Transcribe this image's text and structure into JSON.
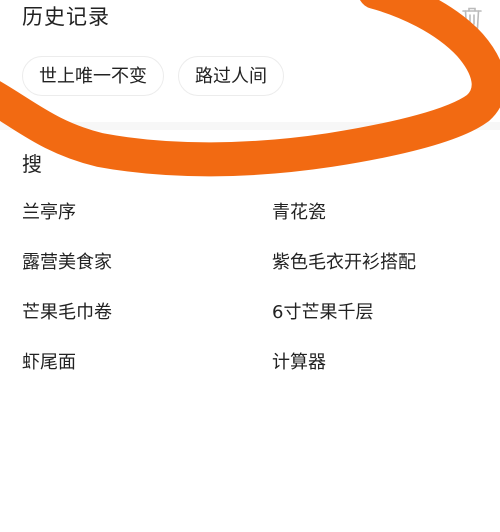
{
  "history": {
    "title": "历史记录",
    "chips": [
      "世上唯一不变",
      "路过人间"
    ]
  },
  "discover": {
    "title_visible": "搜",
    "items": [
      "兰亭序",
      "青花瓷",
      "露营美食家",
      "紫色毛衣开衫搭配",
      "芒果毛巾卷",
      "6寸芒果千层",
      "虾尾面",
      "计算器"
    ]
  },
  "icons": {
    "delete": "trash-icon"
  },
  "colors": {
    "scribble": "#F26A12",
    "text": "#222222",
    "chip_border": "#ececec",
    "icon": "#bbbbbb"
  }
}
